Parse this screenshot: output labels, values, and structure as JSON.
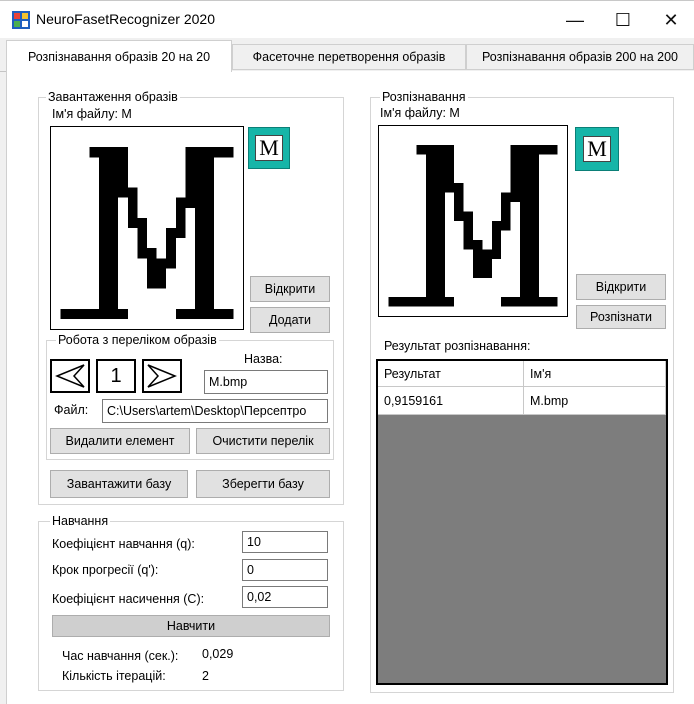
{
  "window": {
    "title": "NeuroFasetRecognizer 2020",
    "minimize_glyph": "—",
    "maximize_glyph": "☐",
    "close_glyph": "✕"
  },
  "tabs": [
    {
      "label": "Розпізнавання образів 20 на 20",
      "active": true
    },
    {
      "label": "Фасеточне перетворення образів",
      "active": false
    },
    {
      "label": "Розпізнавання образів 200 на 200",
      "active": false
    }
  ],
  "load_group": {
    "legend": "Завантаження образів",
    "filename_label": "Ім'я файлу: M",
    "thumb_letter": "M",
    "open_button": "Відкрити",
    "add_button": "Додати"
  },
  "list_group": {
    "legend": "Робота з переліком образів",
    "index_value": "1",
    "name_label": "Назва:",
    "name_value": "M.bmp",
    "file_label": "Файл:",
    "file_value": "C:\\Users\\artem\\Desktop\\Персептро",
    "delete_button": "Видалити елемент",
    "clear_button": "Очистити перелік"
  },
  "base": {
    "load_button": "Завантажити базу",
    "save_button": "Зберегти базу"
  },
  "training": {
    "legend": "Навчання",
    "rate_label": "Коефіцієнт навчання (q):",
    "rate_value": "10",
    "step_label": "Крок прогресії (q'):",
    "step_value": "0",
    "sat_label": "Коефіцієнт насичення (С):",
    "sat_value": "0,02",
    "train_button": "Навчити",
    "time_label": "Час навчання (сек.):",
    "time_value": "0,029",
    "iter_label": "Кількість ітерацій:",
    "iter_value": "2"
  },
  "recognition": {
    "legend": "Розпізнавання",
    "filename_label": "Ім'я файлу: M",
    "thumb_letter": "M",
    "open_button": "Відкрити",
    "recognize_button": "Розпізнати",
    "result_label": "Результат розпізнавання:",
    "columns": [
      "Результат",
      "Ім'я"
    ],
    "rows": [
      {
        "result": "0,9159161",
        "name": "M.bmp"
      }
    ]
  },
  "icons": {
    "app": "app-window-icon",
    "prev": "arrow-left-icon",
    "next": "arrow-right-icon"
  },
  "colors": {
    "thumb_bg": "#16b5a8",
    "grid_bg": "#7d7d7d"
  }
}
